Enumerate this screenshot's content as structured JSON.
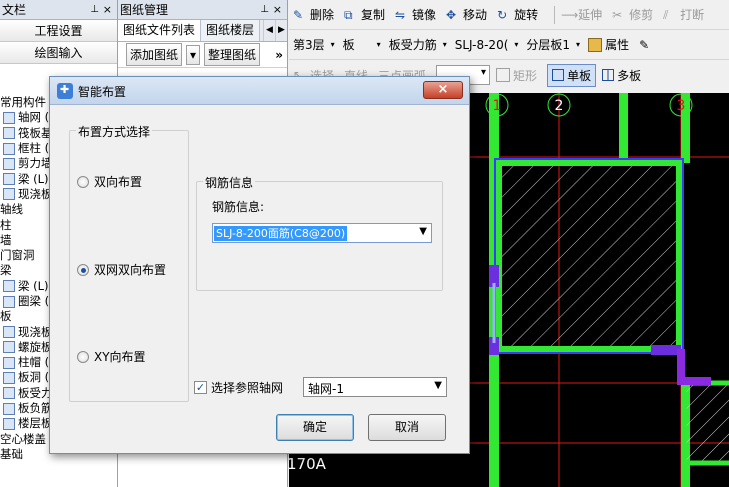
{
  "left_panel": {
    "header_title": "文栏",
    "pin_icon": "pin-icon",
    "close_label": "×",
    "nav_buttons": [
      "工程设置",
      "绘图输入"
    ],
    "tree_items": [
      {
        "label": "常用构件",
        "icon": false
      },
      {
        "label": "轴网 (",
        "icon": true
      },
      {
        "label": "筏板基",
        "icon": true
      },
      {
        "label": "框柱 (",
        "icon": true
      },
      {
        "label": "剪力墙",
        "icon": true
      },
      {
        "label": "梁 (L)",
        "icon": true
      },
      {
        "label": "现浇板",
        "icon": true
      },
      {
        "label": "轴线",
        "icon": false
      },
      {
        "label": "柱",
        "icon": false
      },
      {
        "label": "墙",
        "icon": false
      },
      {
        "label": "门窗洞",
        "icon": false
      },
      {
        "label": "梁",
        "icon": false
      },
      {
        "label": "梁 (L)",
        "icon": true
      },
      {
        "label": "圈梁 (",
        "icon": true
      },
      {
        "label": "板",
        "icon": false
      },
      {
        "label": "现浇板",
        "icon": true
      },
      {
        "label": "螺旋板",
        "icon": true
      },
      {
        "label": "柱帽 (",
        "icon": true
      },
      {
        "label": "板洞 (",
        "icon": true
      },
      {
        "label": "板受力",
        "icon": true
      },
      {
        "label": "板负筋",
        "icon": true
      },
      {
        "label": "楼层板",
        "icon": true
      },
      {
        "label": "空心楼盖",
        "icon": false
      },
      {
        "label": "基础",
        "icon": false
      }
    ]
  },
  "middle_panel": {
    "header_title": "图纸管理",
    "tabs": [
      "图纸文件列表",
      "图纸楼层"
    ],
    "tab_prev": "◀",
    "tab_next": "▶",
    "add_drawing_label": "添加图纸",
    "add_drawing_arrow": "▾",
    "organize_label": "整理图纸",
    "more_label": "»"
  },
  "toolbar": {
    "row1": [
      {
        "label": "删除",
        "icon": "brush-icon",
        "enabled": true
      },
      {
        "label": "复制",
        "icon": "copy-icon",
        "enabled": true
      },
      {
        "label": "镜像",
        "icon": "mirror-icon",
        "enabled": true
      },
      {
        "label": "移动",
        "icon": "move-icon",
        "enabled": true
      },
      {
        "label": "旋转",
        "icon": "rotate-icon",
        "enabled": true
      },
      {
        "label": "延伸",
        "icon": "extend-icon",
        "enabled": false
      },
      {
        "label": "修剪",
        "icon": "trim-icon",
        "enabled": false
      },
      {
        "label": "打断",
        "icon": "break-icon",
        "enabled": false
      }
    ],
    "row2": {
      "floor": "第3层",
      "category": "板",
      "type": "板受力筋",
      "component": "SLJ-8-20(",
      "layer": "分层板1",
      "properties_label": "属性"
    },
    "row3": {
      "select_label": "选择",
      "line_label": "直线",
      "arc_label": "三点画弧",
      "rect_label": "矩形",
      "single_label": "单板",
      "multi_label": "多板"
    }
  },
  "canvas": {
    "axis_labels": [
      "1",
      "2",
      "3"
    ],
    "dimension_text": "170A"
  },
  "dialog": {
    "title": "智能布置",
    "close_label": "×",
    "group_method_title": "布置方式选择",
    "options": [
      {
        "label": "双向布置",
        "checked": false
      },
      {
        "label": "双网双向布置",
        "checked": true
      },
      {
        "label": "XY向布置",
        "checked": false
      }
    ],
    "group_rebar_title": "钢筋信息",
    "rebar_label": "钢筋信息:",
    "rebar_value": "SLJ-8-200面筋(C8@200)",
    "axis_checkbox_label": "选择参照轴网",
    "axis_checkbox_checked": true,
    "axis_value": "轴网-1",
    "ok_label": "确定",
    "cancel_label": "取消"
  },
  "colors": {
    "canvas_bg": "#000000",
    "slab_green": "#32e832",
    "slab_blue": "#3b3bff",
    "grid_red": "#e01818",
    "purple": "#8a2be2"
  }
}
